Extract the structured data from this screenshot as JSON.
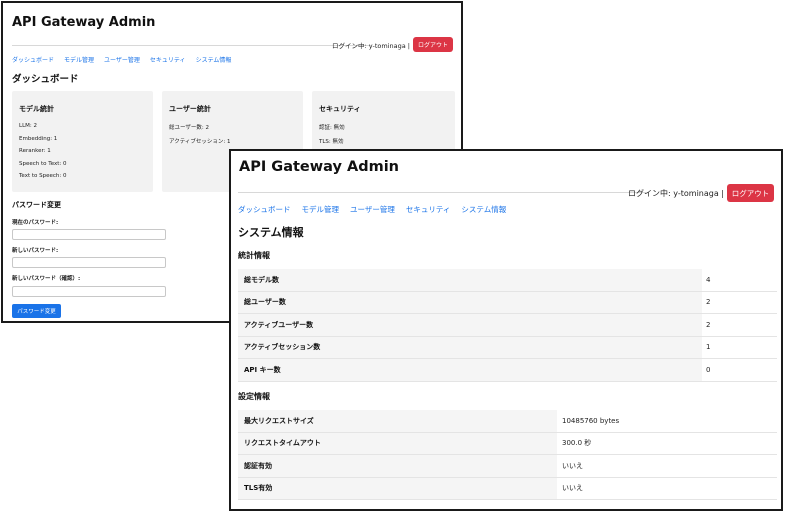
{
  "app_title": "API Gateway Admin",
  "login_text": "ログイン中: y-tominaga |",
  "logout_label": "ログアウト",
  "nav": [
    "ダッシュボード",
    "モデル管理",
    "ユーザー管理",
    "セキュリティ",
    "システム情報"
  ],
  "dashboard": {
    "heading": "ダッシュボード",
    "cards": [
      {
        "title": "モデル統計",
        "lines": [
          "LLM: 2",
          "Embedding: 1",
          "Reranker: 1",
          "Speech to Text: 0",
          "Text to Speech: 0"
        ]
      },
      {
        "title": "ユーザー統計",
        "lines": [
          "総ユーザー数: 2",
          "アクティブセッション: 1"
        ]
      },
      {
        "title": "セキュリティ",
        "lines": [
          "認証: 無効",
          "TLS: 無効"
        ]
      }
    ],
    "password": {
      "heading": "パスワード変更",
      "current_label": "現在のパスワード:",
      "new_label": "新しいパスワード:",
      "confirm_label": "新しいパスワード（確認）:",
      "submit_label": "パスワード変更"
    }
  },
  "system_info": {
    "heading": "システム情報",
    "stats_heading": "統計情報",
    "stats": [
      {
        "label": "総モデル数",
        "value": "4"
      },
      {
        "label": "総ユーザー数",
        "value": "2"
      },
      {
        "label": "アクティブユーザー数",
        "value": "2"
      },
      {
        "label": "アクティブセッション数",
        "value": "1"
      },
      {
        "label": "API キー数",
        "value": "0"
      }
    ],
    "settings_heading": "設定情報",
    "settings": [
      {
        "label": "最大リクエストサイズ",
        "value": "10485760 bytes"
      },
      {
        "label": "リクエストタイムアウト",
        "value": "300.0 秒"
      },
      {
        "label": "認証有効",
        "value": "いいえ"
      },
      {
        "label": "TLS有効",
        "value": "いいえ"
      }
    ]
  }
}
